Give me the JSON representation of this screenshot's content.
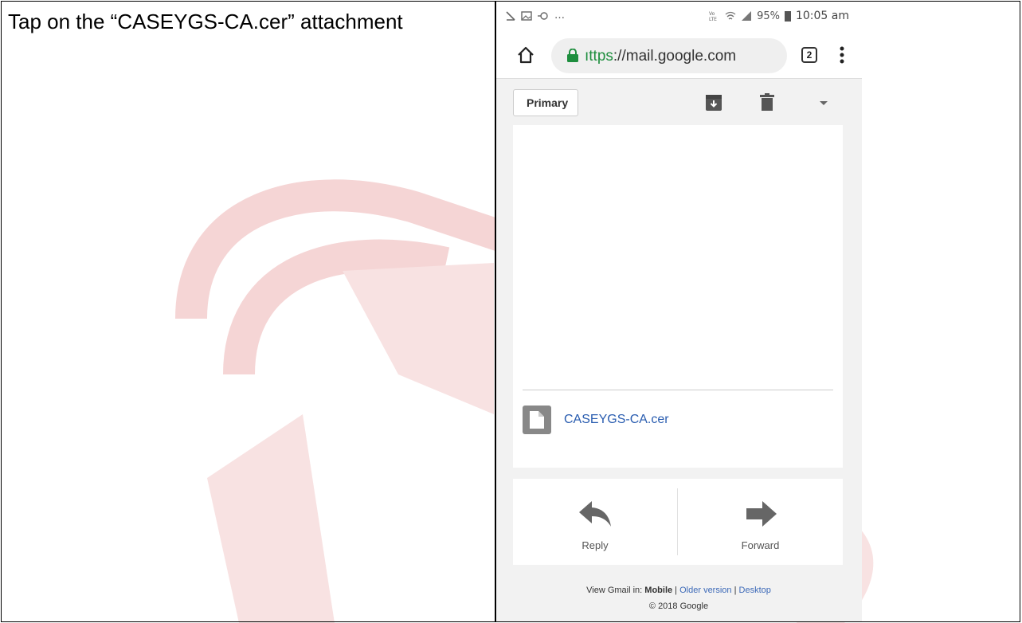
{
  "instruction": {
    "text": "Tap on the “CASEYGS-CA.cer” attachment"
  },
  "status_bar": {
    "left_text": "…",
    "battery": "95%",
    "time": "10:05 am"
  },
  "browser": {
    "url_scheme": "ıttps",
    "url_rest": "://mail.google.com",
    "tab_count": "2"
  },
  "gmail": {
    "folder_label": "Primary",
    "attachment_name": "CASEYGS-CA.cer",
    "reply_label": "Reply",
    "forward_label": "Forward",
    "footer": {
      "view_prefix": "View Gmail in: ",
      "mode_mobile": "Mobile",
      "sep1": " | ",
      "mode_older": "Older version",
      "sep2": " | ",
      "mode_desktop": "Desktop",
      "copyright": "© 2018 Google"
    }
  },
  "colors": {
    "watermark": "#f3d3d3",
    "link": "#3d6ab8",
    "secure_green": "#1e8e3e"
  }
}
